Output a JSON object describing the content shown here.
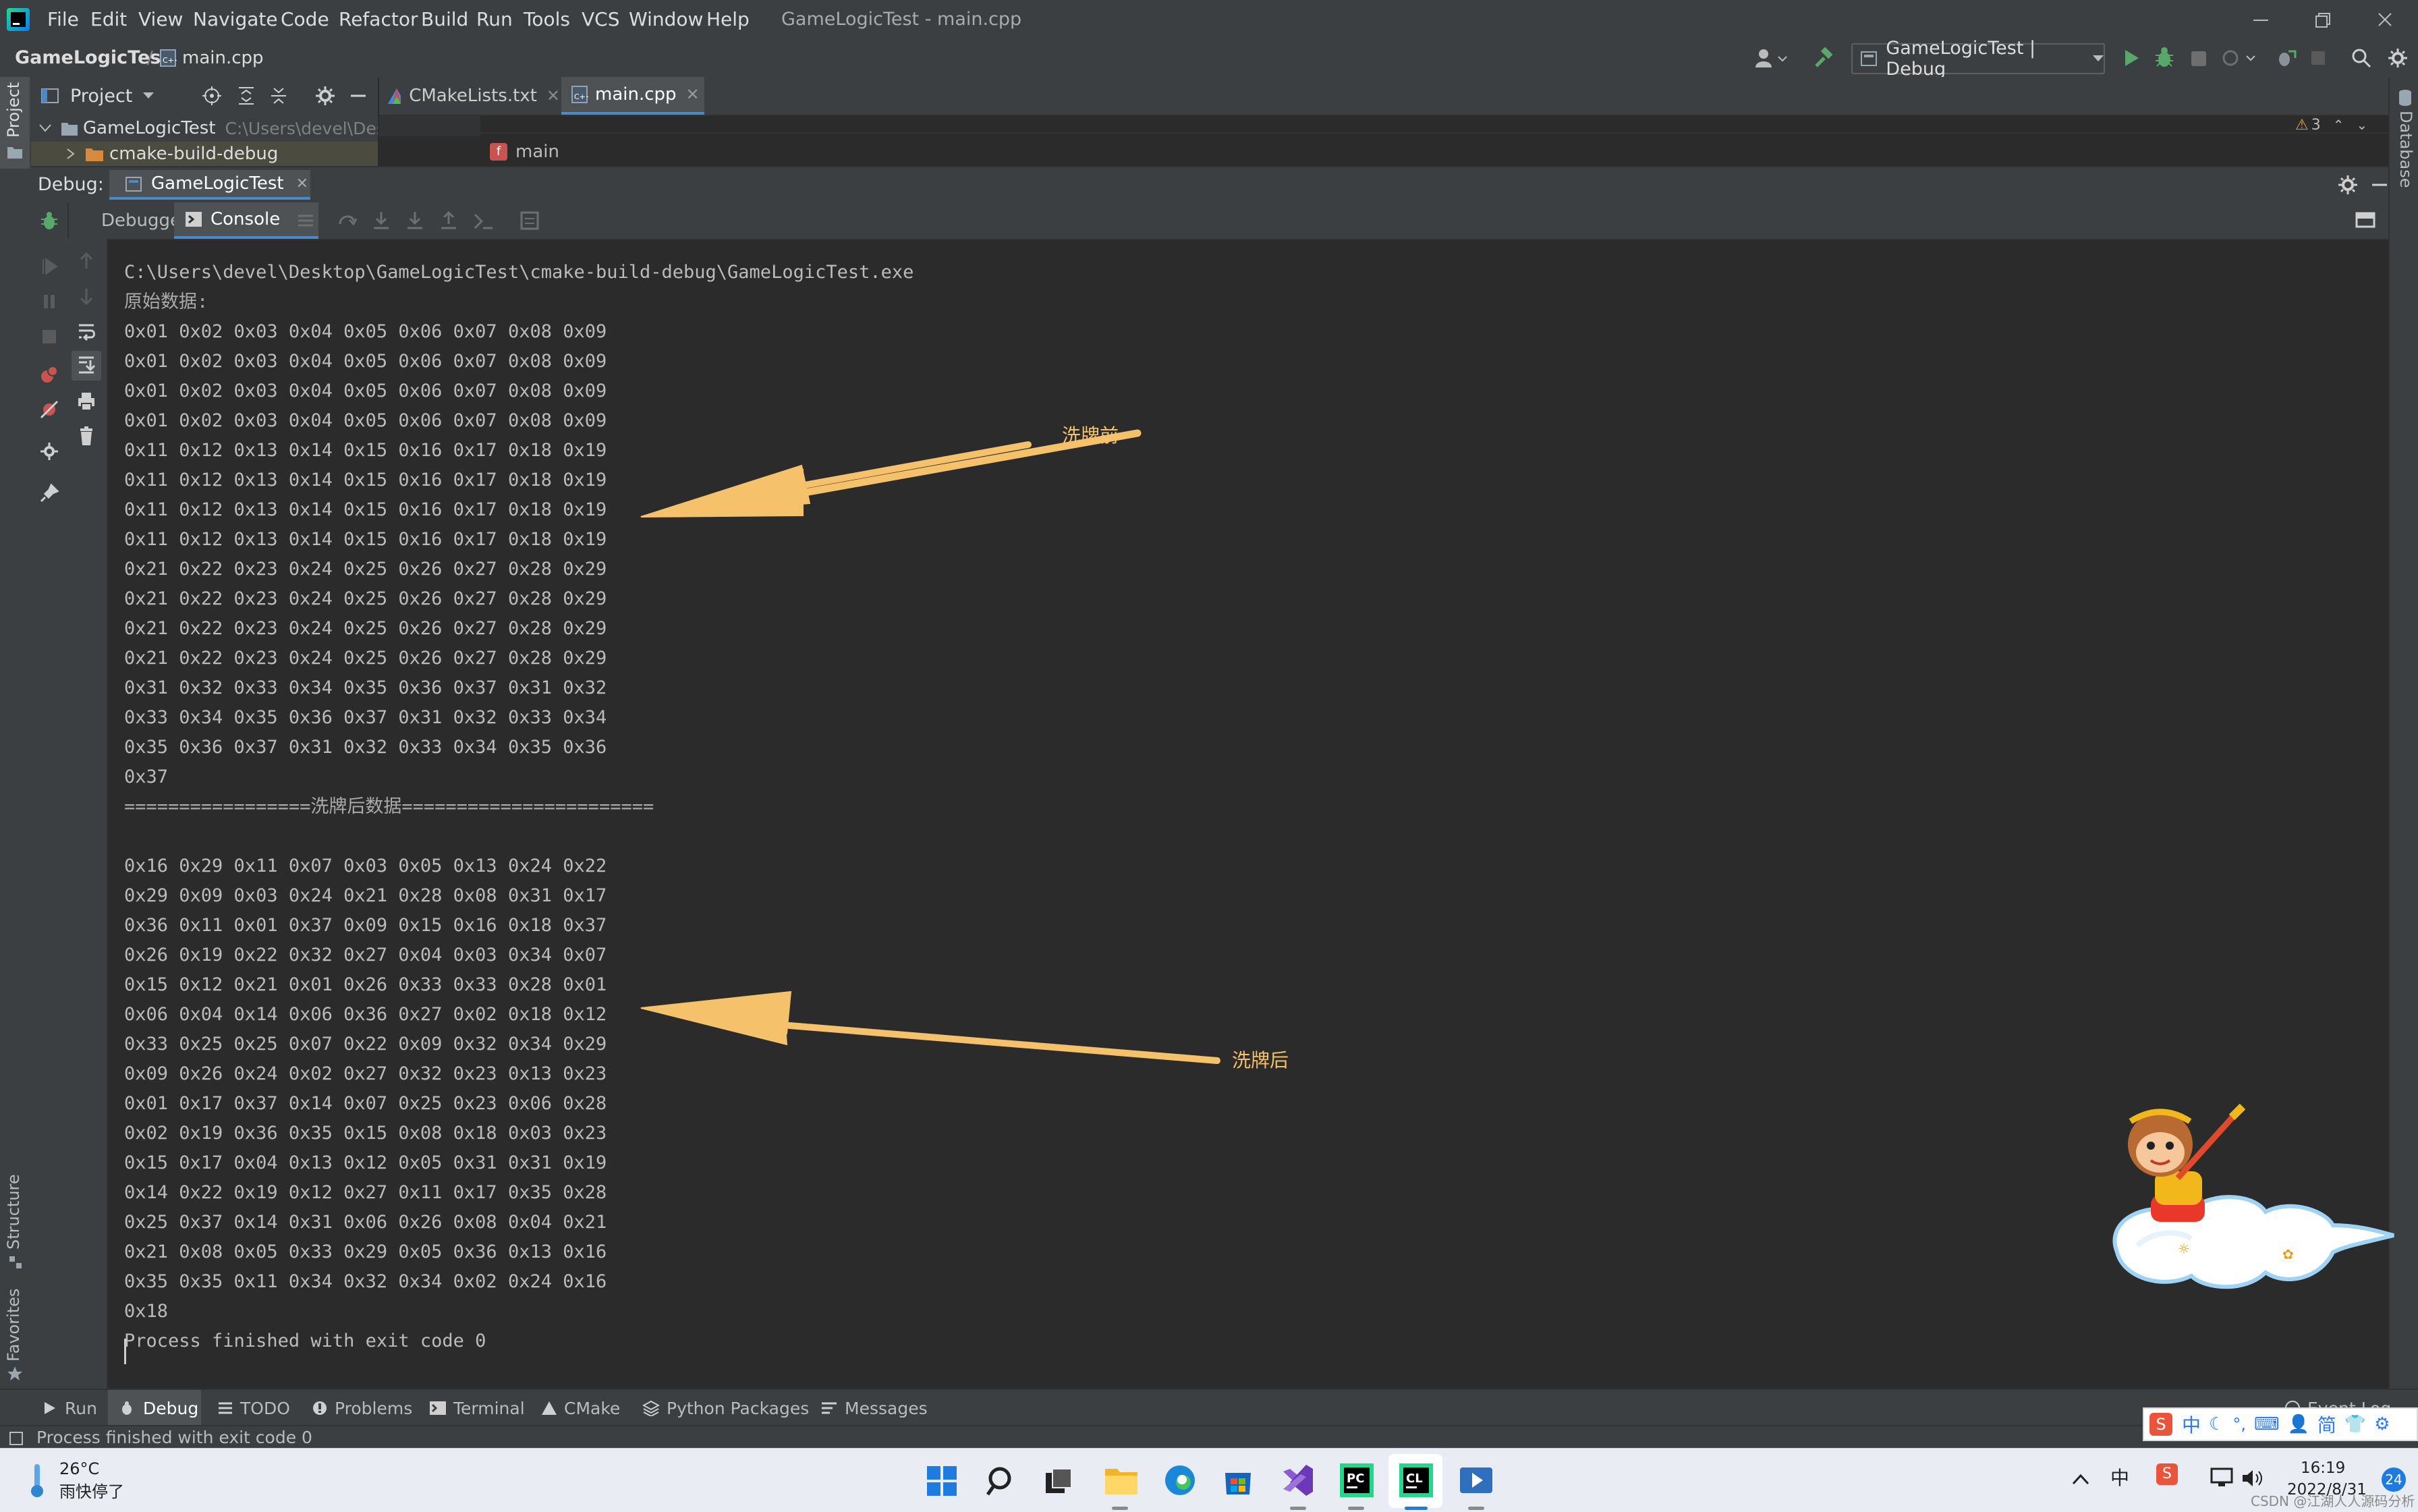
{
  "menu": {
    "items": [
      "File",
      "Edit",
      "View",
      "Navigate",
      "Code",
      "Refactor",
      "Build",
      "Run",
      "Tools",
      "VCS",
      "Window",
      "Help"
    ],
    "window_title": "GameLogicTest - main.cpp"
  },
  "nav": {
    "breadcrumb_project": "GameLogicTest",
    "breadcrumb_file": "main.cpp",
    "run_config": "GameLogicTest | Debug"
  },
  "project_pane": {
    "header": "Project",
    "root_name": "GameLogicTest",
    "root_path": "C:\\Users\\devel\\Desk",
    "child": "cmake-build-debug"
  },
  "editor": {
    "tabs": [
      "CMakeLists.txt",
      "main.cpp"
    ],
    "crumb": "main",
    "warning_count": "3"
  },
  "debug": {
    "label": "Debug:",
    "session": "GameLogicTest",
    "tab_debugger": "Debugger",
    "tab_console": "Console"
  },
  "console": {
    "lines": [
      "C:\\Users\\devel\\Desktop\\GameLogicTest\\cmake-build-debug\\GameLogicTest.exe",
      "原始数据:",
      "0x01 0x02 0x03 0x04 0x05 0x06 0x07 0x08 0x09",
      "0x01 0x02 0x03 0x04 0x05 0x06 0x07 0x08 0x09",
      "0x01 0x02 0x03 0x04 0x05 0x06 0x07 0x08 0x09",
      "0x01 0x02 0x03 0x04 0x05 0x06 0x07 0x08 0x09",
      "0x11 0x12 0x13 0x14 0x15 0x16 0x17 0x18 0x19",
      "0x11 0x12 0x13 0x14 0x15 0x16 0x17 0x18 0x19",
      "0x11 0x12 0x13 0x14 0x15 0x16 0x17 0x18 0x19",
      "0x11 0x12 0x13 0x14 0x15 0x16 0x17 0x18 0x19",
      "0x21 0x22 0x23 0x24 0x25 0x26 0x27 0x28 0x29",
      "0x21 0x22 0x23 0x24 0x25 0x26 0x27 0x28 0x29",
      "0x21 0x22 0x23 0x24 0x25 0x26 0x27 0x28 0x29",
      "0x21 0x22 0x23 0x24 0x25 0x26 0x27 0x28 0x29",
      "0x31 0x32 0x33 0x34 0x35 0x36 0x37 0x31 0x32",
      "0x33 0x34 0x35 0x36 0x37 0x31 0x32 0x33 0x34",
      "0x35 0x36 0x37 0x31 0x32 0x33 0x34 0x35 0x36",
      "0x37",
      "=================洗牌后数据=======================",
      "",
      "0x16 0x29 0x11 0x07 0x03 0x05 0x13 0x24 0x22",
      "0x29 0x09 0x03 0x24 0x21 0x28 0x08 0x31 0x17",
      "0x36 0x11 0x01 0x37 0x09 0x15 0x16 0x18 0x37",
      "0x26 0x19 0x22 0x32 0x27 0x04 0x03 0x34 0x07",
      "0x15 0x12 0x21 0x01 0x26 0x33 0x33 0x28 0x01",
      "0x06 0x04 0x14 0x06 0x36 0x27 0x02 0x18 0x12",
      "0x33 0x25 0x25 0x07 0x22 0x09 0x32 0x34 0x29",
      "0x09 0x26 0x24 0x02 0x27 0x32 0x23 0x13 0x23",
      "0x01 0x17 0x37 0x14 0x07 0x25 0x23 0x06 0x28",
      "0x02 0x19 0x36 0x35 0x15 0x08 0x18 0x03 0x23",
      "0x15 0x17 0x04 0x13 0x12 0x05 0x31 0x31 0x19",
      "0x14 0x22 0x19 0x12 0x27 0x11 0x17 0x35 0x28",
      "0x25 0x37 0x14 0x31 0x06 0x26 0x08 0x04 0x21",
      "0x21 0x08 0x05 0x33 0x29 0x05 0x36 0x13 0x16",
      "0x35 0x35 0x11 0x34 0x32 0x34 0x02 0x24 0x16",
      "0x18",
      "Process finished with exit code 0"
    ]
  },
  "annotations": {
    "before": "洗牌前",
    "after": "洗牌后"
  },
  "side_labels": {
    "project": "Project",
    "structure": "Structure",
    "favorites": "Favorites",
    "database": "Database"
  },
  "bottom_tabs": [
    "Run",
    "Debug",
    "TODO",
    "Problems",
    "Terminal",
    "CMake",
    "Python Packages",
    "Messages"
  ],
  "event_log": "Event Log",
  "status": {
    "message": "Process finished with exit code 0"
  },
  "ime": [
    "中",
    "简"
  ],
  "taskbar": {
    "weather_temp": "26°C",
    "weather_desc": "雨快停了",
    "time": "16:19",
    "date": "2022/8/31",
    "notif_count": "24",
    "watermark": "CSDN @江湖人人源码分析"
  },
  "colors": {
    "accent_arrow": "#f5c26b",
    "ide_bg": "#2b2b2b",
    "panel_bg": "#3c3f41"
  }
}
